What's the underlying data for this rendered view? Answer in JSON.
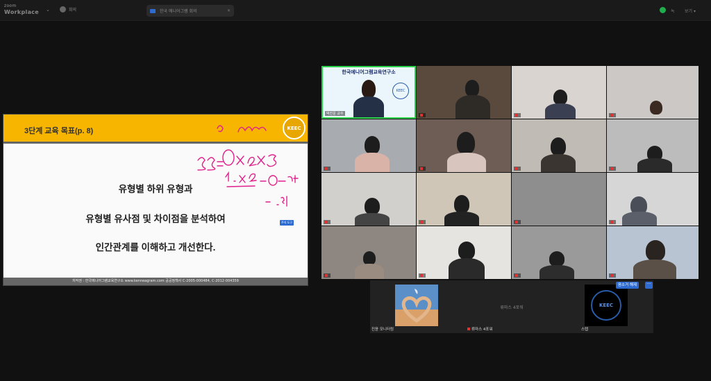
{
  "topbar": {
    "brand_small": "zoom",
    "brand_name": "Workplace",
    "caret": "⌄",
    "host_label": "회의",
    "meeting_label": "한국 에니어그램 회의",
    "meeting_close": "✕",
    "record_label": "녹",
    "view_label": "보기 ▾"
  },
  "slide": {
    "title": "3단계 교육 목표(p. 8)",
    "logo_text": "KEEC",
    "lines": [
      "유형별 하위 유형과",
      "유형별 유사점 및 차이점을 분석하여",
      "인간관계를 이해하고 개선한다."
    ],
    "footer": "저작권 : 한국에니어그램교육연구소    www.kenneagram.com    공공정책사 C-2005-000484, C-2012-004359",
    "ink_tag": "주석 도구"
  },
  "host_tile": {
    "banner": "한국에니어그램교육연구소",
    "logo_text": "KEEC",
    "name": "박진운 교수"
  },
  "bottom": {
    "left_label": "진윤 모니터링",
    "center_name": "류마스 4포워",
    "center_sub": "류마스 4포워",
    "right_label": "스탭",
    "logo_text": "KEEC",
    "unmute": "음소거 해제",
    "more": "···"
  },
  "colors": {
    "slide_header": "#f7b500",
    "active_border": "#2bd44a",
    "accent": "#2d6bd1",
    "ink": "#e0208c"
  }
}
